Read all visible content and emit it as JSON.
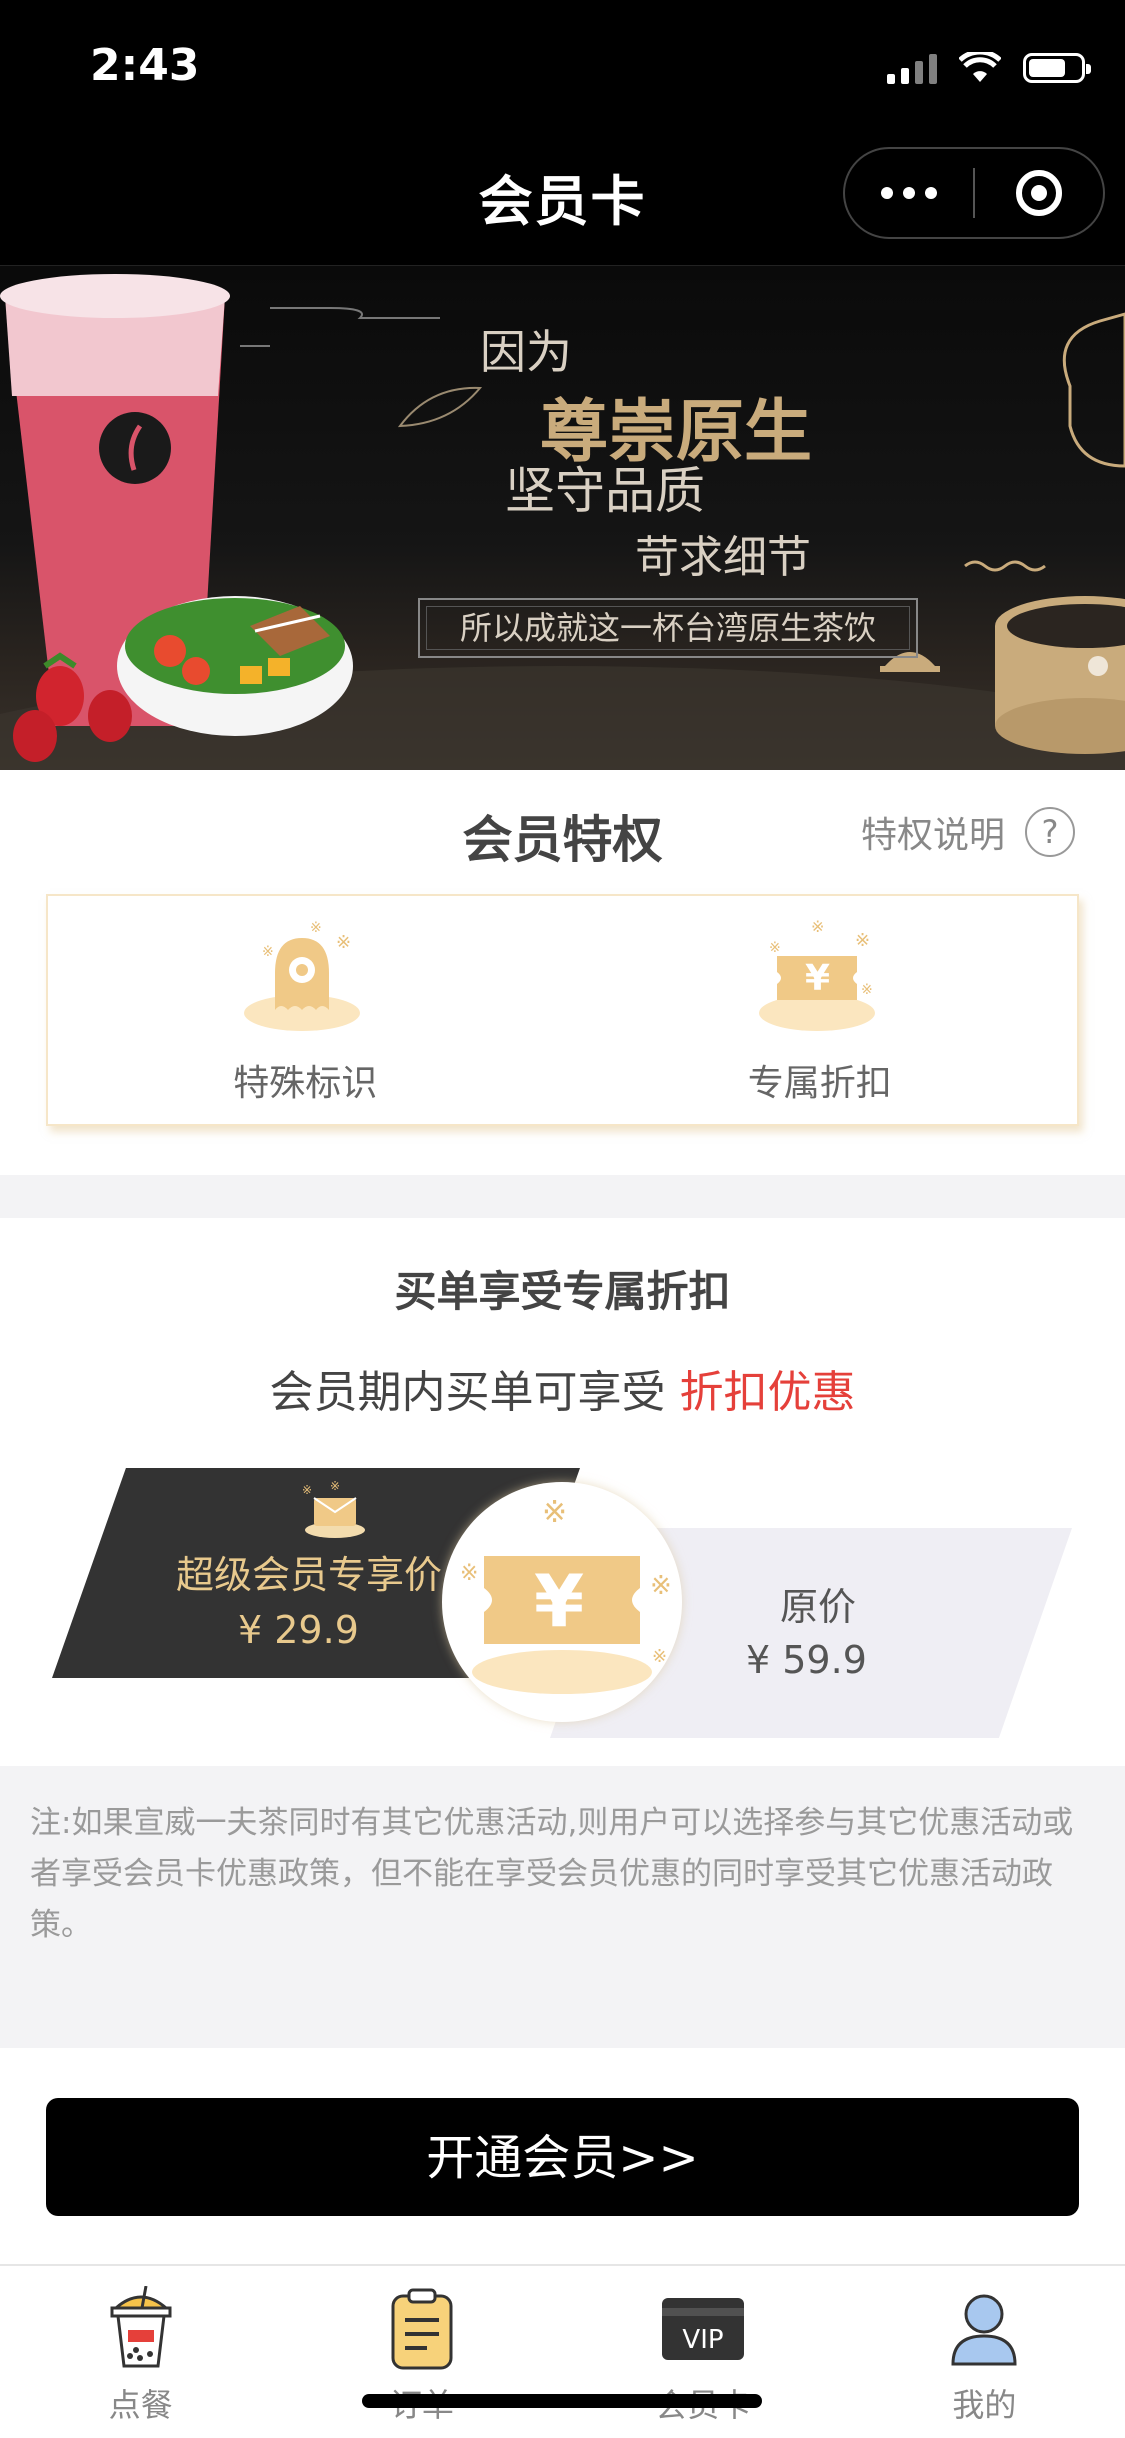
{
  "status_bar": {
    "time": "2:43"
  },
  "nav": {
    "title": "会员卡",
    "capsule_more": "more-icon",
    "capsule_target": "target-icon"
  },
  "banner": {
    "line1": "因为",
    "line2": "尊崇原生",
    "line3": "坚守品质",
    "line4": "苛求细节",
    "box_text": "所以成就这一杯台湾原生茶饮"
  },
  "privileges": {
    "title": "会员特权",
    "explain": "特权说明",
    "items": [
      {
        "label": "特殊标识",
        "icon": "octopus-badge-icon"
      },
      {
        "label": "专属折扣",
        "icon": "discount-coupon-icon"
      }
    ]
  },
  "discount": {
    "title": "买单享受专属折扣",
    "subtitle_prefix": "会员期内买单可享受",
    "subtitle_highlight": "折扣优惠",
    "member_label": "超级会员专享价",
    "member_price": "¥ 29.9",
    "original_label": "原价",
    "original_price": "¥ 59.9"
  },
  "note": "注:如果宣威一夫茶同时有其它优惠活动,则用户可以选择参与其它优惠活动或者享受会员卡优惠政策，但不能在享受会员优惠的同时享受其它优惠活动政策。",
  "open_button": "开通会员>>",
  "tabbar": [
    {
      "label": "点餐",
      "icon": "bubble-tea-icon"
    },
    {
      "label": "订单",
      "icon": "order-clipboard-icon"
    },
    {
      "label": "会员卡",
      "icon": "vip-card-icon",
      "icon_text": "VIP"
    },
    {
      "label": "我的",
      "icon": "user-icon"
    }
  ],
  "colors": {
    "accent_gold": "#e8c98d",
    "highlight_red": "#e5403a",
    "dark": "#333333"
  }
}
